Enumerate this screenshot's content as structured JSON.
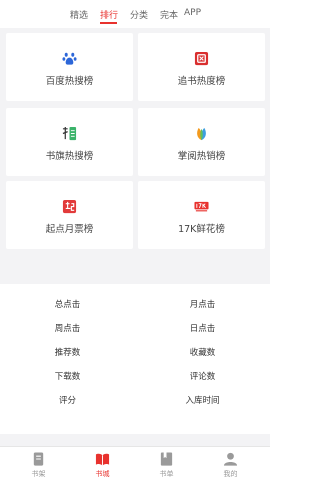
{
  "top_tabs": [
    {
      "label": "精选",
      "active": false
    },
    {
      "label": "排行",
      "active": true
    },
    {
      "label": "分类",
      "active": false
    },
    {
      "label": "完本",
      "active": false
    },
    {
      "label": "APP",
      "active": false
    }
  ],
  "rank_cards": [
    {
      "label": "百度热搜榜",
      "icon": "baidu-paw-icon",
      "color": "#2c66d8"
    },
    {
      "label": "追书热度榜",
      "icon": "zhuishu-icon",
      "color": "#d92f2f"
    },
    {
      "label": "书旗热搜榜",
      "icon": "shuqi-icon",
      "color": "#3bb36a"
    },
    {
      "label": "掌阅热销榜",
      "icon": "zhangyue-leaf-icon",
      "color": "#f39a1e"
    },
    {
      "label": "起点月票榜",
      "icon": "qidian-icon",
      "color": "#e23a3a"
    },
    {
      "label": "17K鲜花榜",
      "icon": "17k-icon",
      "color": "#e8322e"
    }
  ],
  "sort_options": [
    [
      "总点击",
      "月点击"
    ],
    [
      "周点击",
      "日点击"
    ],
    [
      "推荐数",
      "收藏数"
    ],
    [
      "下载数",
      "评论数"
    ],
    [
      "评分",
      "入库时间"
    ]
  ],
  "bottom_nav": [
    {
      "label": "书架",
      "icon": "bookshelf-icon",
      "active": false
    },
    {
      "label": "书城",
      "icon": "bookstore-icon",
      "active": true
    },
    {
      "label": "书单",
      "icon": "booklist-icon",
      "active": false
    },
    {
      "label": "我的",
      "icon": "profile-icon",
      "active": false
    }
  ],
  "colors": {
    "accent": "#e8322e",
    "background": "#f3f3f5"
  }
}
